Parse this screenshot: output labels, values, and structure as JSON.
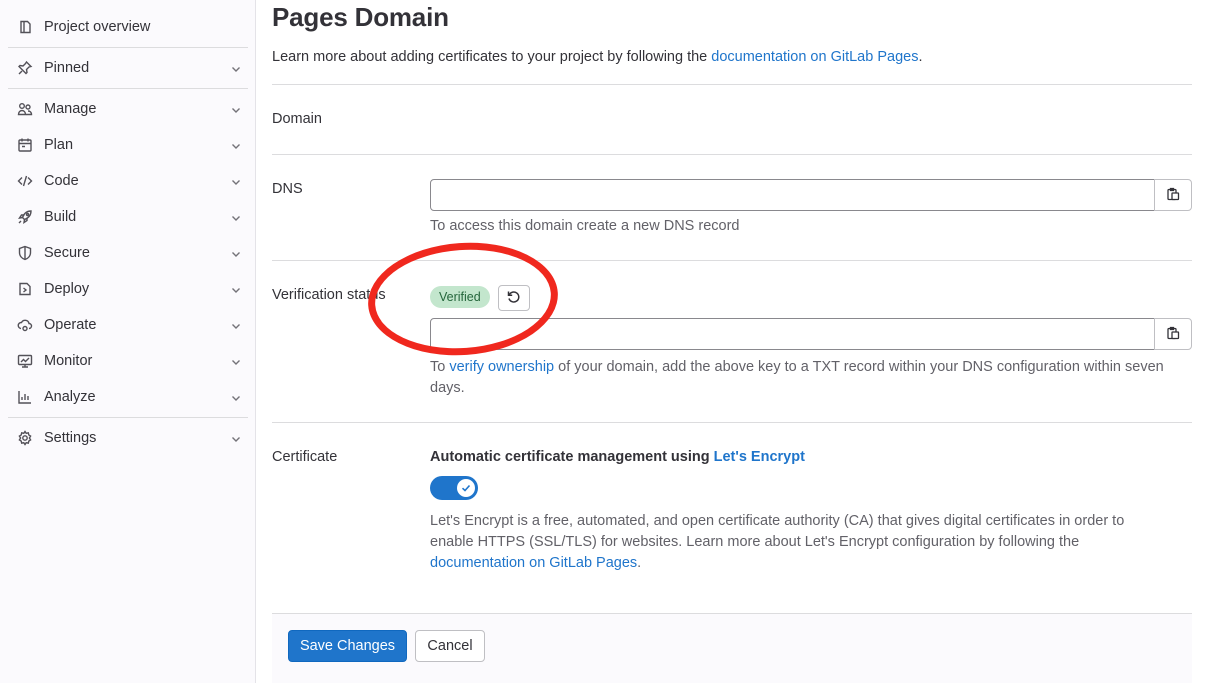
{
  "sidebar": {
    "items": [
      {
        "label": "Project overview",
        "icon": "project-icon",
        "chevron": false
      },
      {
        "label": "Pinned",
        "icon": "thumbtack-icon",
        "chevron": true
      },
      {
        "label": "Manage",
        "icon": "users-icon",
        "chevron": true
      },
      {
        "label": "Plan",
        "icon": "planning-icon",
        "chevron": true
      },
      {
        "label": "Code",
        "icon": "code-icon",
        "chevron": true
      },
      {
        "label": "Build",
        "icon": "rocket-icon",
        "chevron": true
      },
      {
        "label": "Secure",
        "icon": "shield-icon",
        "chevron": true
      },
      {
        "label": "Deploy",
        "icon": "deployments-icon",
        "chevron": true
      },
      {
        "label": "Operate",
        "icon": "cloud-gear-icon",
        "chevron": true
      },
      {
        "label": "Monitor",
        "icon": "monitor-icon",
        "chevron": true
      },
      {
        "label": "Analyze",
        "icon": "chart-icon",
        "chevron": true
      },
      {
        "label": "Settings",
        "icon": "settings-icon",
        "chevron": true
      }
    ]
  },
  "page": {
    "title": "Pages Domain",
    "intro_prefix": "Learn more about adding certificates to your project by following the ",
    "intro_link": "documentation on GitLab Pages",
    "intro_suffix": "."
  },
  "domain": {
    "label": "Domain"
  },
  "dns": {
    "label": "DNS",
    "value": "",
    "help": "To access this domain create a new DNS record"
  },
  "verification": {
    "label": "Verification status",
    "badge": "Verified",
    "value": "",
    "help_prefix": "To ",
    "help_link": "verify ownership",
    "help_suffix_line1": " of your domain, add the above key to a TXT record within your DNS configuration within seven",
    "help_suffix_line2": "days."
  },
  "certificate": {
    "label": "Certificate",
    "title_prefix": "Automatic certificate management using ",
    "title_link": "Let's Encrypt",
    "toggle_on": true,
    "desc_line1": "Let's Encrypt is a free, automated, and open certificate authority (CA) that gives digital certificates in order to",
    "desc_line2": "enable HTTPS (SSL/TLS) for websites. Learn more about Let's Encrypt configuration by following the",
    "desc_link": "documentation on GitLab Pages",
    "desc_suffix": "."
  },
  "footer": {
    "save_label": "Save Changes",
    "cancel_label": "Cancel"
  },
  "colors": {
    "primary": "#1f75cb",
    "badge_bg": "#c3e6cd",
    "badge_text": "#24663b",
    "annotation": "#f0281e"
  }
}
